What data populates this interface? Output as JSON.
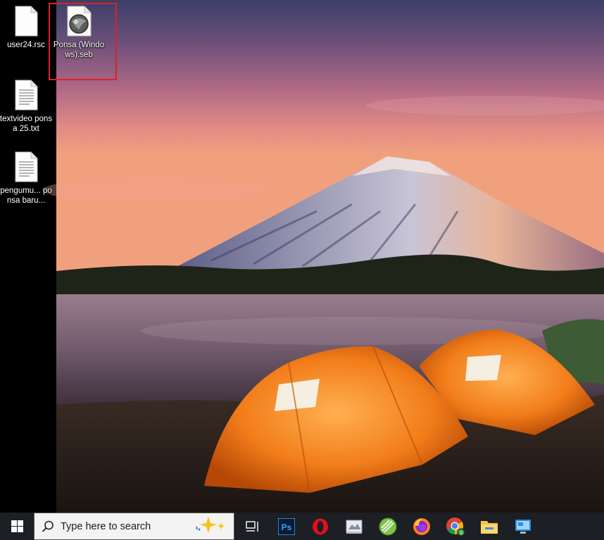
{
  "desktop": {
    "icons": [
      {
        "name": "user24.rsc",
        "type": "file"
      },
      {
        "name": "Ponsa (Windows).seb",
        "type": "seb"
      },
      {
        "name": "textvideo ponsa 25.txt",
        "type": "text"
      },
      {
        "name": "pengumu... ponsa baru...",
        "type": "text"
      }
    ],
    "selected_icon": "Ponsa (Windows).seb",
    "highlight_color": "#e02020"
  },
  "taskbar": {
    "search_placeholder": "Type here to search",
    "background": "#1c1f24",
    "apps": [
      {
        "icon": "task-view-icon"
      },
      {
        "icon": "photoshop-icon",
        "label": "Ps"
      },
      {
        "icon": "opera-icon"
      },
      {
        "icon": "image-viewer-icon"
      },
      {
        "icon": "green-app-icon"
      },
      {
        "icon": "firefox-icon"
      },
      {
        "icon": "chrome-icon"
      },
      {
        "icon": "file-explorer-icon"
      },
      {
        "icon": "remote-desktop-icon"
      }
    ]
  }
}
